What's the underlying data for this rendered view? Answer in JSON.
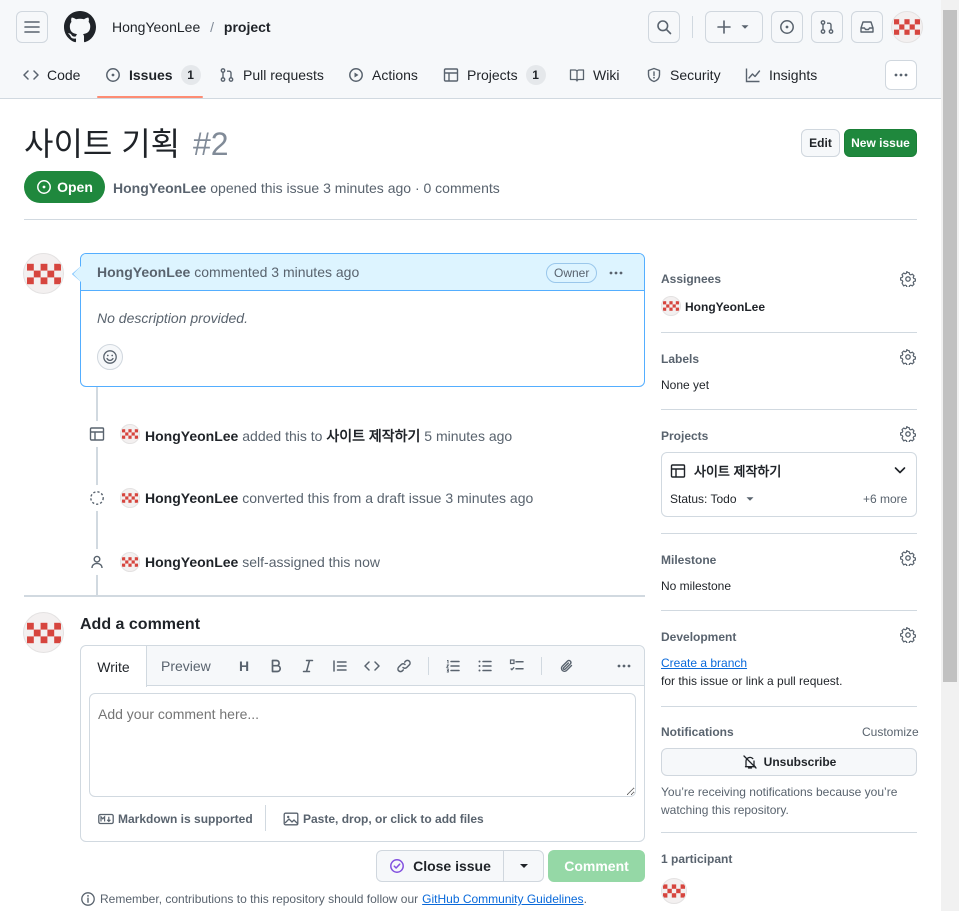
{
  "header": {
    "owner": "HongYeonLee",
    "separator": "/",
    "repo": "project"
  },
  "tabs": [
    {
      "label": "Code"
    },
    {
      "label": "Issues",
      "count": "1"
    },
    {
      "label": "Pull requests"
    },
    {
      "label": "Actions"
    },
    {
      "label": "Projects",
      "count": "1"
    },
    {
      "label": "Wiki"
    },
    {
      "label": "Security"
    },
    {
      "label": "Insights"
    }
  ],
  "issue": {
    "title": "사이트 기획",
    "number": "#2",
    "state": "Open",
    "author": "HongYeonLee",
    "meta": "opened this issue 3 minutes ago · 0 comments",
    "edit_label": "Edit",
    "new_issue_label": "New issue"
  },
  "comment": {
    "author": "HongYeonLee",
    "meta": "commented 3 minutes ago",
    "badge": "Owner",
    "body": "No description provided."
  },
  "timeline": [
    {
      "actor": "HongYeonLee",
      "text1": "added this to",
      "project": "사이트 제작하기",
      "text2": "5 minutes ago"
    },
    {
      "actor": "HongYeonLee",
      "text1": "converted this from a draft issue 3 minutes ago"
    },
    {
      "actor": "HongYeonLee",
      "text1": "self-assigned this now"
    }
  ],
  "composer": {
    "heading": "Add a comment",
    "write_tab": "Write",
    "preview_tab": "Preview",
    "placeholder": "Add your comment here...",
    "markdown_note": "Markdown is supported",
    "attach_note": "Paste, drop, or click to add files",
    "close_issue_label": "Close issue",
    "comment_label": "Comment",
    "footer_prefix": "Remember, contributions to this repository should follow our",
    "footer_link": "GitHub Community Guidelines",
    "footer_suffix": "."
  },
  "sidebar": {
    "assignees": {
      "title": "Assignees",
      "value": "HongYeonLee"
    },
    "labels": {
      "title": "Labels",
      "value": "None yet"
    },
    "projects": {
      "title": "Projects",
      "name": "사이트 제작하기",
      "status": "Status: Todo",
      "more": "+6 more"
    },
    "milestone": {
      "title": "Milestone",
      "value": "No milestone"
    },
    "development": {
      "title": "Development",
      "link": "Create a branch",
      "value": "for this issue or link a pull request."
    },
    "notifications": {
      "title": "Notifications",
      "customize": "Customize",
      "button": "Unsubscribe",
      "note": "You’re receiving notifications because you’re watching this repository."
    },
    "participants": {
      "title": "1 participant"
    }
  },
  "colors": {
    "open_green": "#1f883d",
    "accent_link": "#0969da",
    "comment_header_bg": "#ddf4ff",
    "tab_underline": "#fd8c73",
    "avatar_red": "#d6453e"
  }
}
